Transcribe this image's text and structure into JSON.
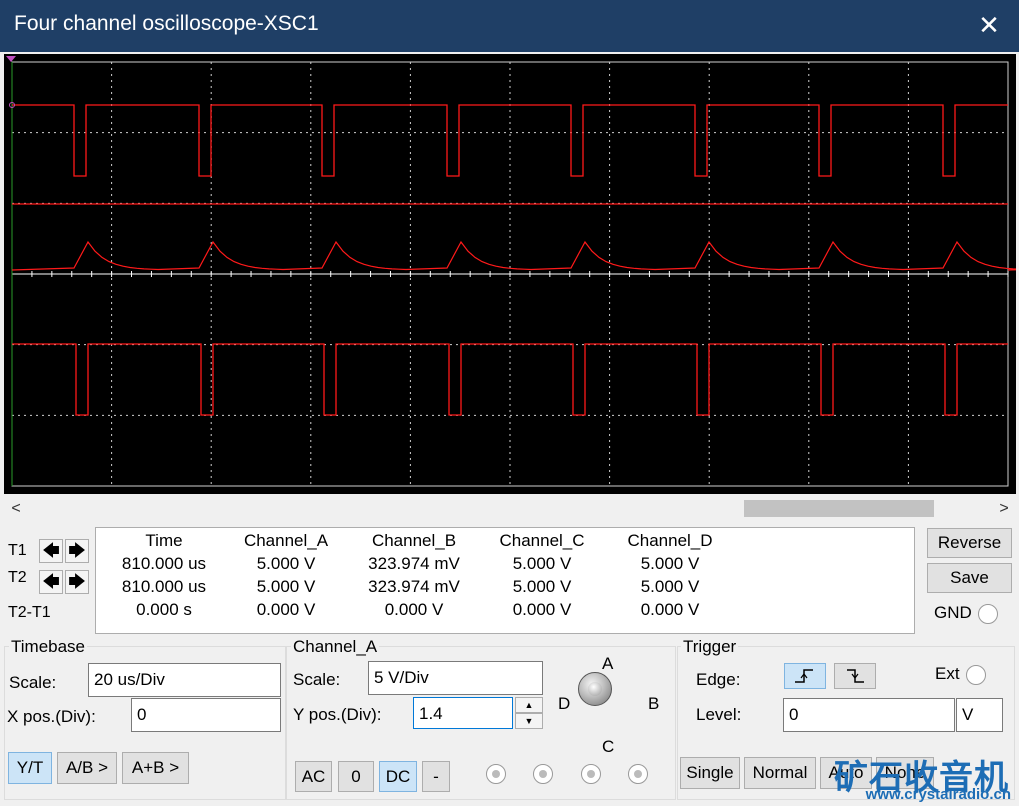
{
  "window": {
    "title": "Four channel oscilloscope-XSC1",
    "close_glyph": "✕"
  },
  "scroll": {
    "left_glyph": "<",
    "right_glyph": ">"
  },
  "cursors": {
    "t1_label": "T1",
    "t2_label": "T2",
    "t2t1_label": "T2-T1",
    "left_glyph": "🡄",
    "right_glyph": "🡆"
  },
  "readout": {
    "headers": [
      "Time",
      "Channel_A",
      "Channel_B",
      "Channel_C",
      "Channel_D"
    ],
    "rows": [
      [
        "810.000 us",
        "5.000 V",
        "323.974 mV",
        "5.000 V",
        "5.000 V"
      ],
      [
        "810.000 us",
        "5.000 V",
        "323.974 mV",
        "5.000 V",
        "5.000 V"
      ],
      [
        "0.000 s",
        "0.000 V",
        "0.000 V",
        "0.000 V",
        "0.000 V"
      ]
    ]
  },
  "side_buttons": {
    "reverse": "Reverse",
    "save": "Save",
    "gnd": "GND"
  },
  "timebase": {
    "title": "Timebase",
    "scale_label": "Scale:",
    "scale_value": "20 us/Div",
    "xpos_label": "X pos.(Div):",
    "xpos_value": "0",
    "yt": "Y/T",
    "ab": "A/B >",
    "apb": "A+B >"
  },
  "channel": {
    "title": "Channel_A",
    "scale_label": "Scale:",
    "scale_value": "5  V/Div",
    "ypos_label": "Y pos.(Div):",
    "ypos_value": "1.4",
    "knob_labels": {
      "a": "A",
      "b": "B",
      "c": "C",
      "d": "D"
    },
    "ac": "AC",
    "zero": "0",
    "dc": "DC",
    "minus": "-"
  },
  "trigger": {
    "title": "Trigger",
    "edge_label": "Edge:",
    "ext_label": "Ext",
    "level_label": "Level:",
    "level_value": "0",
    "level_unit": "V",
    "single": "Single",
    "normal": "Normal",
    "auto": "Auto",
    "none": "None"
  },
  "watermark": {
    "cn": "矿石收音机",
    "url": "www.crystalradio.cn"
  },
  "colors": {
    "trace": "#ff1a1a",
    "grid": "#cfcfcf",
    "screen": "#000000",
    "titlebar": "#1f3f66"
  }
}
